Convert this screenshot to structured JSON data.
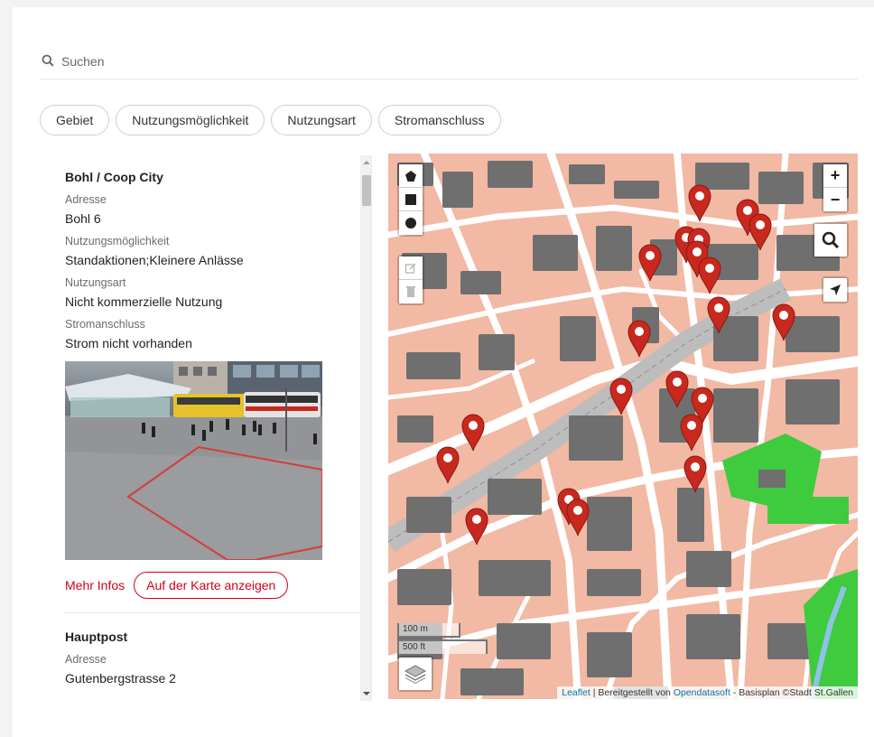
{
  "search": {
    "placeholder": "Suchen",
    "icon": "search-icon"
  },
  "filters": [
    {
      "label": "Gebiet"
    },
    {
      "label": "Nutzungsmöglichkeit"
    },
    {
      "label": "Nutzungsart"
    },
    {
      "label": "Stromanschluss"
    }
  ],
  "entries": [
    {
      "title": "Bohl / Coop City",
      "address_label": "Adresse",
      "address": "Bohl 6",
      "usage_label": "Nutzungsmöglichkeit",
      "usage": "Standaktionen;Kleinere Anlässe",
      "type_label": "Nutzungsart",
      "type": "Nicht kommerzielle Nutzung",
      "power_label": "Stromanschluss",
      "power": "Strom nicht vorhanden",
      "more_label": "Mehr Infos",
      "map_button_label": "Auf der Karte anzeigen"
    },
    {
      "title": "Hauptpost",
      "address_label": "Adresse",
      "address": "Gutenbergstrasse 2"
    }
  ],
  "map": {
    "zoom_in_label": "+",
    "zoom_out_label": "−",
    "scale_metric": "100 m",
    "scale_imperial": "500 ft",
    "attribution": {
      "leaflet": "Leaflet",
      "sep": " | Bereitgestellt von ",
      "provider": "Opendatasoft",
      "rest": " - Basisplan ©Stadt St.Gallen"
    },
    "marker_count": 21,
    "colors": {
      "marker": "#c8281e",
      "building": "#6f6f6f",
      "ground": "#f2b9a4",
      "park": "#3ecb3e",
      "street": "#ffffff"
    }
  },
  "colors": {
    "accent": "#d0021b"
  }
}
